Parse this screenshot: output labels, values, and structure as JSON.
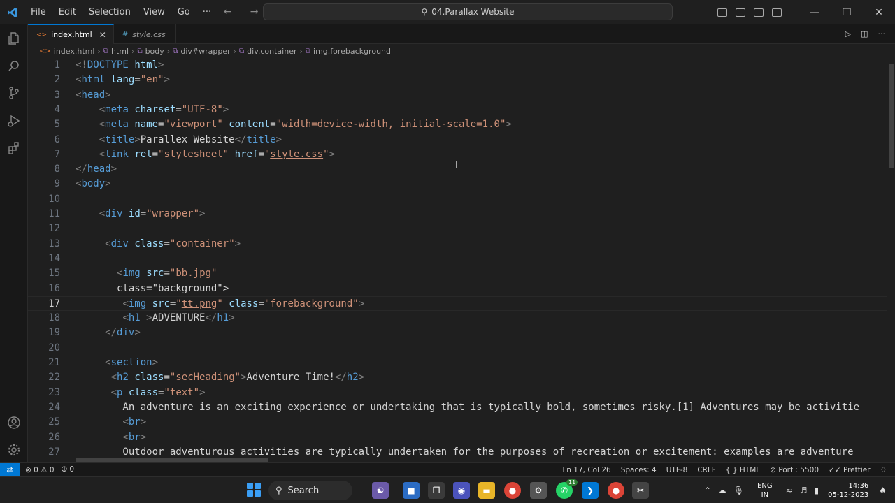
{
  "titlebar": {
    "menu": [
      "File",
      "Edit",
      "Selection",
      "View",
      "Go",
      "···"
    ],
    "search_text": "04.Parallax Website"
  },
  "tabs": [
    {
      "label": "index.html",
      "active": true
    },
    {
      "label": "style.css",
      "active": false
    }
  ],
  "breadcrumbs": [
    "index.html",
    "html",
    "body",
    "div#wrapper",
    "div.container",
    "img.forebackground"
  ],
  "editor": {
    "line_numbers": [
      "1",
      "2",
      "3",
      "4",
      "5",
      "6",
      "7",
      "8",
      "9",
      "10",
      "11",
      "12",
      "13",
      "14",
      "15",
      "16",
      "17",
      "18",
      "19",
      "20",
      "21",
      "22",
      "23",
      "24",
      "25",
      "26",
      "27"
    ],
    "current_line": 17,
    "lines": [
      "<!DOCTYPE html>",
      "<html lang=\"en\">",
      "<head>",
      "    <meta charset=\"UTF-8\">",
      "    <meta name=\"viewport\" content=\"width=device-width, initial-scale=1.0\">",
      "    <title>Parallex Website</title>",
      "    <link rel=\"stylesheet\" href=\"style.css\">",
      "</head>",
      "<body>",
      "",
      "    <div id=\"wrapper\">",
      "",
      "     <div class=\"container\">",
      "",
      "       <img src=\"bb.jpg\"",
      "       class=\"background\">",
      "        <img src=\"tt.png\" class=\"forebackground\">",
      "        <h1 >ADVENTURE</h1>",
      "     </div>",
      "",
      "     <section>",
      "      <h2 class=\"secHeading\">Adventure Time!</h2>",
      "      <p class=\"text\">",
      "        An adventure is an exciting experience or undertaking that is typically bold, sometimes risky.[1] Adventures may be activitie",
      "        <br>",
      "        <br>",
      "        Outdoor adventurous activities are typically undertaken for the purposes of recreation or excitement: examples are adventure"
    ]
  },
  "statusbar": {
    "errors": "0",
    "warnings": "0",
    "ports": "0",
    "position": "Ln 17, Col 26",
    "spaces": "Spaces: 4",
    "encoding": "UTF-8",
    "eol": "CRLF",
    "language": "HTML",
    "port": "Port : 5500",
    "formatter": "Prettier"
  },
  "taskbar": {
    "search_label": "Search",
    "lang_top": "ENG",
    "lang_bottom": "IN",
    "time": "14:36",
    "date": "05-12-2023",
    "whatsapp_badge": "11"
  },
  "colors": {
    "accent": "#0078d4",
    "tag": "#569cd6",
    "attribute": "#9cdcfe",
    "string": "#ce9178",
    "html_icon": "#e37933",
    "css_icon": "#519aba"
  }
}
